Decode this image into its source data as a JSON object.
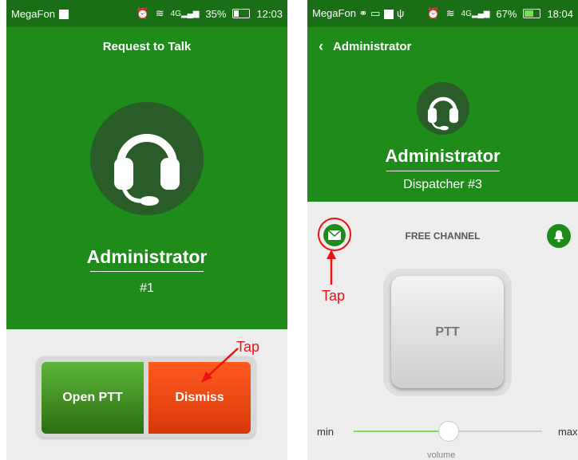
{
  "left": {
    "status": {
      "carrier": "MegaFon",
      "battery": "35%",
      "battery_level": 0.35,
      "time": "12:03",
      "network": "4G"
    },
    "title": "Request to Talk",
    "avatar_icon": "headset-icon",
    "name": "Administrator",
    "subtitle": "#1",
    "buttons": {
      "open_ptt": "Open PTT",
      "dismiss": "Dismiss"
    },
    "annotation": "Tap"
  },
  "right": {
    "status": {
      "carrier": "MegaFon",
      "battery": "67%",
      "battery_level": 0.67,
      "time": "18:04",
      "network": "4G"
    },
    "title": "Administrator",
    "avatar_icon": "headset-icon",
    "name": "Administrator",
    "subtitle": "Dispatcher #3",
    "channel": "FREE CHANNEL",
    "ptt_label": "PTT",
    "volume": {
      "min": "min",
      "max": "max",
      "label": "volume",
      "level": 0.5
    },
    "annotation": "Tap"
  },
  "colors": {
    "primary_green": "#1f8b1b",
    "status_green": "#1a6e16",
    "dismiss_orange": "#ff4a12",
    "annotation_red": "#ee1111"
  }
}
